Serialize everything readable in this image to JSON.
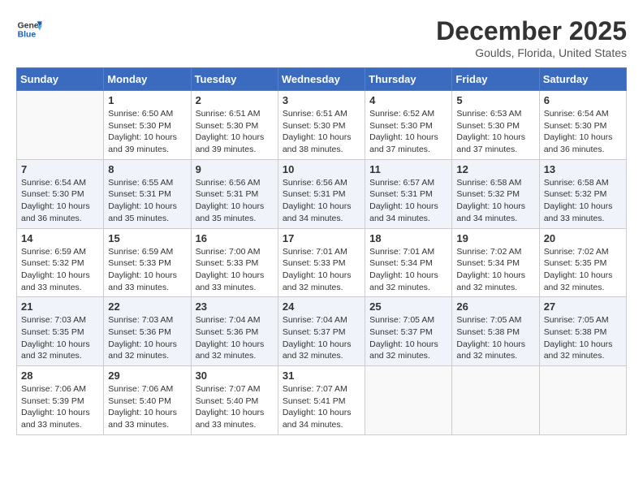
{
  "header": {
    "logo_line1": "General",
    "logo_line2": "Blue",
    "month": "December 2025",
    "location": "Goulds, Florida, United States"
  },
  "weekdays": [
    "Sunday",
    "Monday",
    "Tuesday",
    "Wednesday",
    "Thursday",
    "Friday",
    "Saturday"
  ],
  "weeks": [
    [
      {
        "day": "",
        "info": ""
      },
      {
        "day": "1",
        "info": "Sunrise: 6:50 AM\nSunset: 5:30 PM\nDaylight: 10 hours\nand 39 minutes."
      },
      {
        "day": "2",
        "info": "Sunrise: 6:51 AM\nSunset: 5:30 PM\nDaylight: 10 hours\nand 39 minutes."
      },
      {
        "day": "3",
        "info": "Sunrise: 6:51 AM\nSunset: 5:30 PM\nDaylight: 10 hours\nand 38 minutes."
      },
      {
        "day": "4",
        "info": "Sunrise: 6:52 AM\nSunset: 5:30 PM\nDaylight: 10 hours\nand 37 minutes."
      },
      {
        "day": "5",
        "info": "Sunrise: 6:53 AM\nSunset: 5:30 PM\nDaylight: 10 hours\nand 37 minutes."
      },
      {
        "day": "6",
        "info": "Sunrise: 6:54 AM\nSunset: 5:30 PM\nDaylight: 10 hours\nand 36 minutes."
      }
    ],
    [
      {
        "day": "7",
        "info": "Sunrise: 6:54 AM\nSunset: 5:30 PM\nDaylight: 10 hours\nand 36 minutes."
      },
      {
        "day": "8",
        "info": "Sunrise: 6:55 AM\nSunset: 5:31 PM\nDaylight: 10 hours\nand 35 minutes."
      },
      {
        "day": "9",
        "info": "Sunrise: 6:56 AM\nSunset: 5:31 PM\nDaylight: 10 hours\nand 35 minutes."
      },
      {
        "day": "10",
        "info": "Sunrise: 6:56 AM\nSunset: 5:31 PM\nDaylight: 10 hours\nand 34 minutes."
      },
      {
        "day": "11",
        "info": "Sunrise: 6:57 AM\nSunset: 5:31 PM\nDaylight: 10 hours\nand 34 minutes."
      },
      {
        "day": "12",
        "info": "Sunrise: 6:58 AM\nSunset: 5:32 PM\nDaylight: 10 hours\nand 34 minutes."
      },
      {
        "day": "13",
        "info": "Sunrise: 6:58 AM\nSunset: 5:32 PM\nDaylight: 10 hours\nand 33 minutes."
      }
    ],
    [
      {
        "day": "14",
        "info": "Sunrise: 6:59 AM\nSunset: 5:32 PM\nDaylight: 10 hours\nand 33 minutes."
      },
      {
        "day": "15",
        "info": "Sunrise: 6:59 AM\nSunset: 5:33 PM\nDaylight: 10 hours\nand 33 minutes."
      },
      {
        "day": "16",
        "info": "Sunrise: 7:00 AM\nSunset: 5:33 PM\nDaylight: 10 hours\nand 33 minutes."
      },
      {
        "day": "17",
        "info": "Sunrise: 7:01 AM\nSunset: 5:33 PM\nDaylight: 10 hours\nand 32 minutes."
      },
      {
        "day": "18",
        "info": "Sunrise: 7:01 AM\nSunset: 5:34 PM\nDaylight: 10 hours\nand 32 minutes."
      },
      {
        "day": "19",
        "info": "Sunrise: 7:02 AM\nSunset: 5:34 PM\nDaylight: 10 hours\nand 32 minutes."
      },
      {
        "day": "20",
        "info": "Sunrise: 7:02 AM\nSunset: 5:35 PM\nDaylight: 10 hours\nand 32 minutes."
      }
    ],
    [
      {
        "day": "21",
        "info": "Sunrise: 7:03 AM\nSunset: 5:35 PM\nDaylight: 10 hours\nand 32 minutes."
      },
      {
        "day": "22",
        "info": "Sunrise: 7:03 AM\nSunset: 5:36 PM\nDaylight: 10 hours\nand 32 minutes."
      },
      {
        "day": "23",
        "info": "Sunrise: 7:04 AM\nSunset: 5:36 PM\nDaylight: 10 hours\nand 32 minutes."
      },
      {
        "day": "24",
        "info": "Sunrise: 7:04 AM\nSunset: 5:37 PM\nDaylight: 10 hours\nand 32 minutes."
      },
      {
        "day": "25",
        "info": "Sunrise: 7:05 AM\nSunset: 5:37 PM\nDaylight: 10 hours\nand 32 minutes."
      },
      {
        "day": "26",
        "info": "Sunrise: 7:05 AM\nSunset: 5:38 PM\nDaylight: 10 hours\nand 32 minutes."
      },
      {
        "day": "27",
        "info": "Sunrise: 7:05 AM\nSunset: 5:38 PM\nDaylight: 10 hours\nand 32 minutes."
      }
    ],
    [
      {
        "day": "28",
        "info": "Sunrise: 7:06 AM\nSunset: 5:39 PM\nDaylight: 10 hours\nand 33 minutes."
      },
      {
        "day": "29",
        "info": "Sunrise: 7:06 AM\nSunset: 5:40 PM\nDaylight: 10 hours\nand 33 minutes."
      },
      {
        "day": "30",
        "info": "Sunrise: 7:07 AM\nSunset: 5:40 PM\nDaylight: 10 hours\nand 33 minutes."
      },
      {
        "day": "31",
        "info": "Sunrise: 7:07 AM\nSunset: 5:41 PM\nDaylight: 10 hours\nand 34 minutes."
      },
      {
        "day": "",
        "info": ""
      },
      {
        "day": "",
        "info": ""
      },
      {
        "day": "",
        "info": ""
      }
    ]
  ]
}
